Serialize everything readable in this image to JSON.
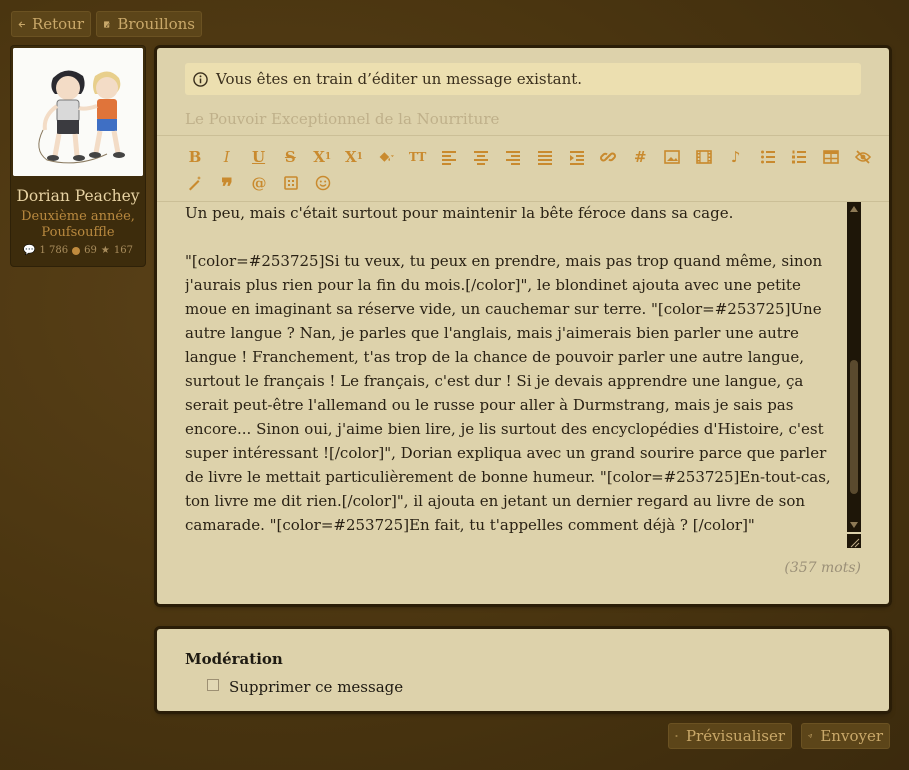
{
  "nav": {
    "back_label": "Retour",
    "drafts_label": "Brouillons"
  },
  "profile": {
    "name": "Dorian Peachey",
    "role_line1": "Deuxième année,",
    "role_line2": "Poufsouffle",
    "messages": "1 786",
    "points": "69",
    "stars": "167"
  },
  "editor": {
    "notice": "Vous êtes en train d’éditer un message existant.",
    "title": "Le Pouvoir Exceptionnel de la Nourriture",
    "toolbar_row1": [
      "bold-icon",
      "italic-icon",
      "underline-icon",
      "strikethrough-icon",
      "subscript-icon",
      "superscript-icon",
      "paint-bucket-icon",
      "font-size-icon",
      "align-left-icon",
      "align-center-icon",
      "align-right-icon",
      "align-justify-icon",
      "indent-icon",
      "link-icon",
      "hashtag-icon",
      "image-icon",
      "film-icon",
      "music-note-icon",
      "bullet-list-icon",
      "numbered-list-icon",
      "table-icon",
      "eye-slash-icon"
    ],
    "toolbar_row2": [
      "magic-wand-icon",
      "quote-icon",
      "at-icon",
      "spoiler-icon",
      "smiley-icon"
    ],
    "line_first": "Un peu, mais c'était surtout pour maintenir la bête féroce dans sa cage.",
    "body": "\"[color=#253725]Si tu veux, tu peux en prendre, mais pas trop quand même, sinon j'aurais plus rien pour la fin du mois.[/color]\", le blondinet ajouta avec une petite moue en imaginant sa réserve vide, un cauchemar sur terre. \"[color=#253725]Une autre langue ? Nan, je parles que l'anglais, mais j'aimerais bien parler une autre langue ! Franchement, t'as trop de la chance de pouvoir parler une autre langue, surtout le français ! Le français, c'est dur ! Si je devais apprendre une langue, ça serait peut-être l'allemand ou le russe pour aller à Durmstrang, mais je sais pas encore... Sinon oui, j'aime bien lire, je lis surtout des encyclopédies d'Histoire, c'est super intéressant ![/color]\", Dorian expliqua avec un grand sourire parce que parler de livre le mettait particulièrement de bonne humeur. \"[color=#253725]En-tout-cas, ton livre me dit rien.[/color]\", il ajouta en jetant un dernier regard au livre de son camarade. \"[color=#253725]En fait, tu t'appelles comment déjà ? [/color]\"",
    "word_count": "(357 mots)"
  },
  "moderation": {
    "title": "Modération",
    "delete_label": "Supprimer ce message"
  },
  "actions": {
    "preview_label": "Prévisualiser",
    "send_label": "Envoyer"
  },
  "colors": {
    "accent": "#c98a2e",
    "background": "#4a3510",
    "panel": "#ddd2ab"
  }
}
